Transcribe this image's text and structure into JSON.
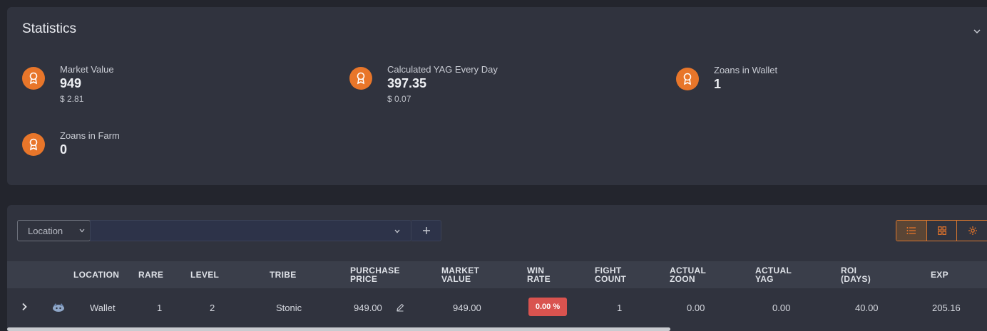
{
  "statistics": {
    "title": "Statistics",
    "items": [
      {
        "label": "Market Value",
        "value": "949",
        "sub": "$ 2.81"
      },
      {
        "label": "Calculated YAG Every Day",
        "value": "397.35",
        "sub": "$ 0.07"
      },
      {
        "label": "Zoans in Wallet",
        "value": "1",
        "sub": ""
      },
      {
        "label": "Zoans in Farm",
        "value": "0",
        "sub": ""
      }
    ]
  },
  "filter": {
    "field_label": "Location",
    "value": ""
  },
  "table": {
    "columns": [
      "LOCATION",
      "RARE",
      "LEVEL",
      "TRIBE",
      "PURCHASE PRICE",
      "MARKET VALUE",
      "WIN RATE",
      "FIGHT COUNT",
      "ACTUAL ZOON",
      "ACTUAL YAG",
      "ROI (DAYS)",
      "EXP"
    ],
    "rows": [
      {
        "location": "Wallet",
        "rare": "1",
        "level": "2",
        "tribe": "Stonic",
        "purchase_price": "949.00",
        "market_value": "949.00",
        "win_rate": "0.00 %",
        "fight_count": "1",
        "actual_zoon": "0.00",
        "actual_yag": "0.00",
        "roi_days": "40.00",
        "exp": "205.16"
      }
    ]
  },
  "colors": {
    "accent": "#e8762a",
    "win_rate_bad": "#d9534f",
    "card_bg": "#30333e",
    "page_bg": "#23252d"
  },
  "icons": {
    "stat_icon": "award-icon",
    "collapse": "chevron-down-icon",
    "list_view": "list-icon",
    "grid_view": "grid-icon",
    "settings": "gear-icon",
    "edit": "pencil-icon",
    "expand_row": "chevron-right-icon",
    "add": "plus-icon"
  }
}
